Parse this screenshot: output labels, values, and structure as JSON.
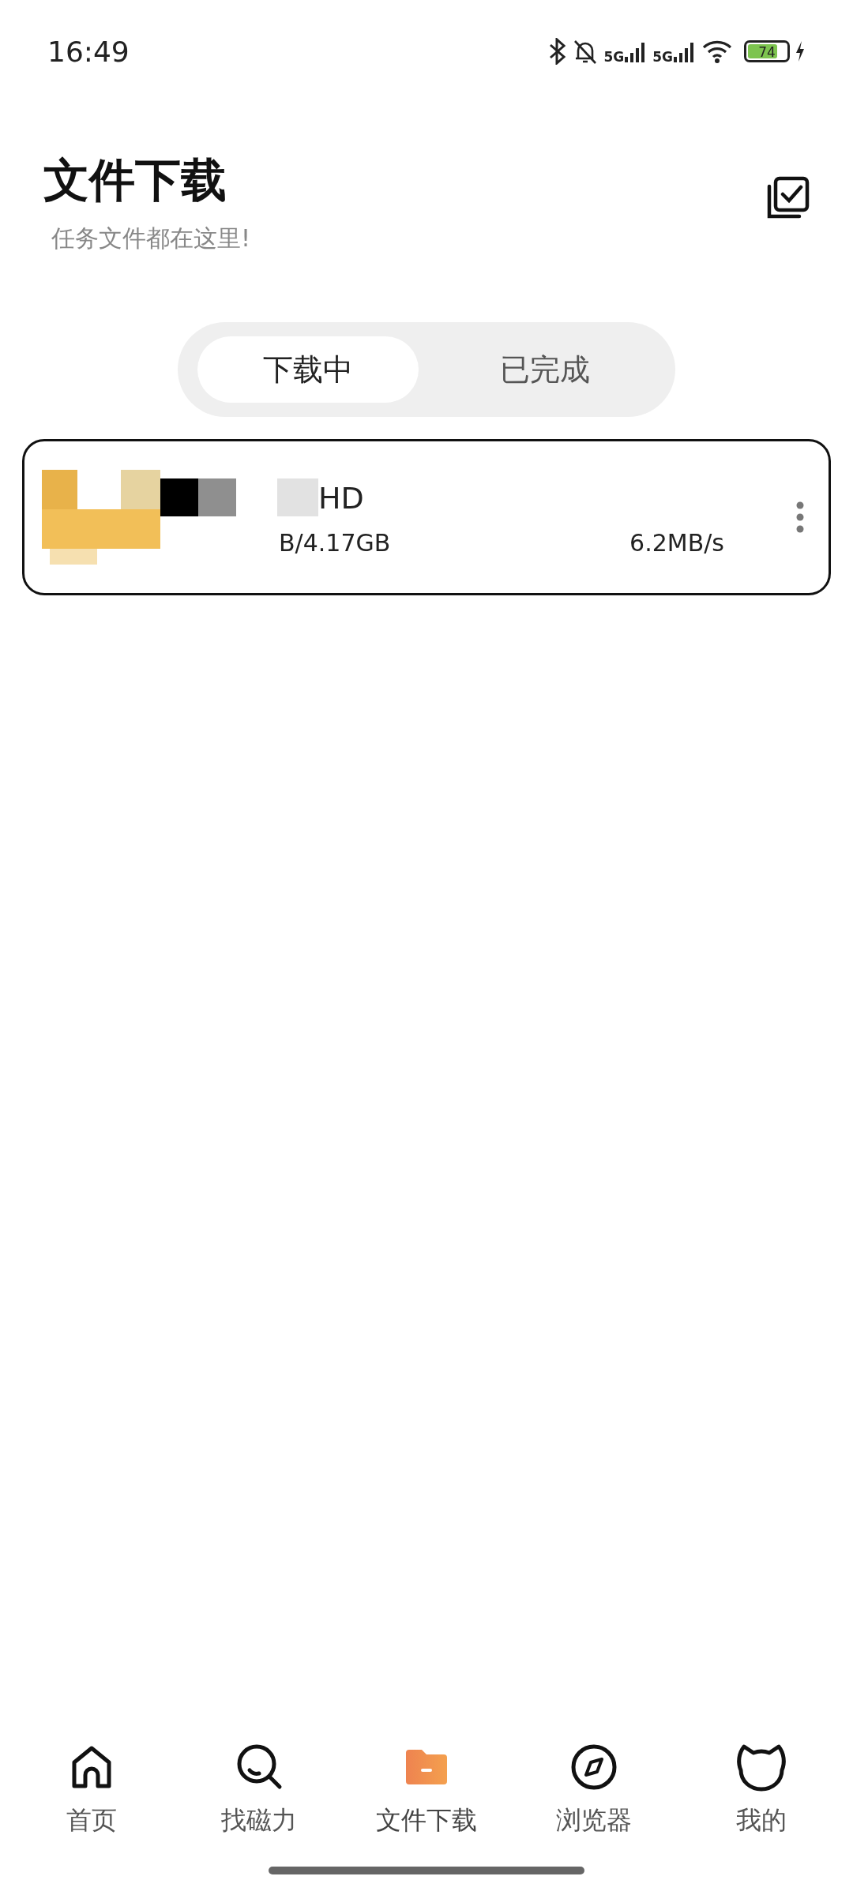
{
  "status_bar": {
    "time": "16:49",
    "network_1": "5G",
    "network_2": "5G",
    "battery": "74"
  },
  "header": {
    "title": "文件下载",
    "subtitle": "任务文件都在这里!"
  },
  "tabs": [
    {
      "label": "下载中",
      "selected": true
    },
    {
      "label": "已完成",
      "selected": false
    }
  ],
  "downloads": [
    {
      "name": "HD",
      "progress": "B/4.17GB",
      "speed": "6.2MB/s"
    }
  ],
  "bottom_nav": [
    {
      "label": "首页",
      "kind": "home",
      "selected": false
    },
    {
      "label": "找磁力",
      "kind": "search",
      "selected": false
    },
    {
      "label": "文件下载",
      "kind": "folder",
      "selected": true
    },
    {
      "label": "浏览器",
      "kind": "compass",
      "selected": false
    },
    {
      "label": "我的",
      "kind": "cat",
      "selected": false
    }
  ]
}
